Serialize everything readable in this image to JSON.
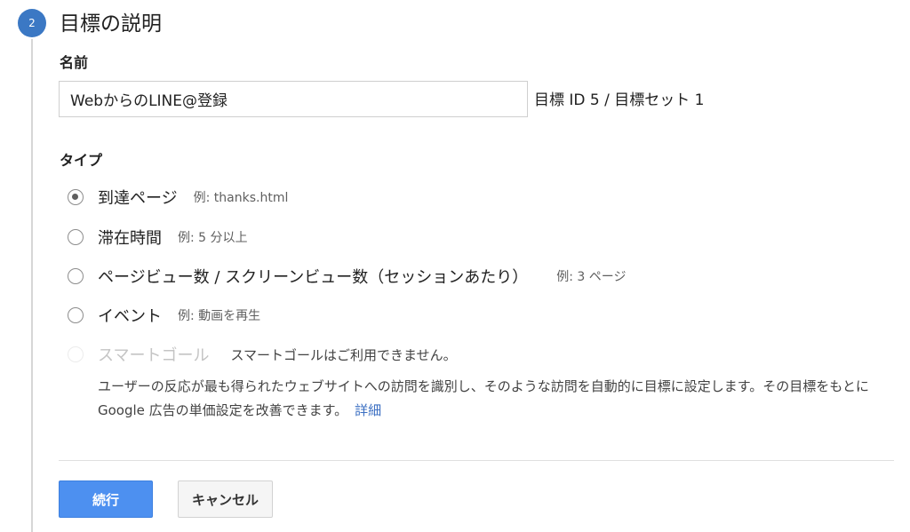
{
  "step": {
    "number": "2",
    "title": "目標の説明"
  },
  "name_field": {
    "label": "名前",
    "value": "WebからのLINE@登録",
    "goal_id": "目標 ID 5 / 目標セット 1"
  },
  "type_field": {
    "label": "タイプ",
    "options": [
      {
        "label": "到達ページ",
        "example": "例: thanks.html",
        "selected": true,
        "disabled": false
      },
      {
        "label": "滞在時間",
        "example": "例: 5 分以上",
        "selected": false,
        "disabled": false
      },
      {
        "label": "ページビュー数 / スクリーンビュー数（セッションあたり）",
        "example": "例: 3 ページ",
        "selected": false,
        "disabled": false
      },
      {
        "label": "イベント",
        "example": "例: 動画を再生",
        "selected": false,
        "disabled": false
      },
      {
        "label": "スマートゴール",
        "note": "スマートゴールはご利用できません。",
        "selected": false,
        "disabled": true
      }
    ],
    "smart_goal_description": "ユーザーの反応が最も得られたウェブサイトへの訪問を識別し、そのような訪問を自動的に目標に設定します。その目標をもとに Google 広告の単価設定を改善できます。",
    "details_link": "詳細"
  },
  "buttons": {
    "continue": "続行",
    "cancel": "キャンセル"
  },
  "colors": {
    "step_badge": "#3b78c4",
    "primary_button": "#4d90f0",
    "link": "#3b6fc2"
  }
}
